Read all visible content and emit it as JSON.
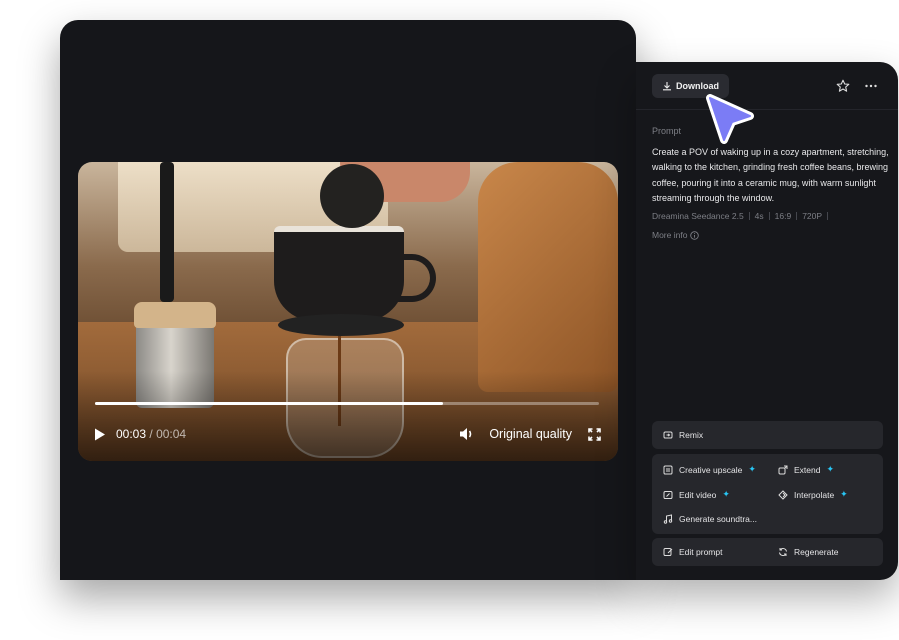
{
  "video": {
    "current_time": "00:03",
    "separator": "/",
    "total_time": "00:04",
    "progress": 0.69,
    "quality_label": "Original quality"
  },
  "panel": {
    "download_label": "Download",
    "prompt_label": "Prompt",
    "prompt_text": "Create a POV of waking up in a cozy apartment, stretching, walking to the kitchen, grinding fresh coffee beans, brewing coffee, pouring it into a ceramic mug, with warm sunlight streaming through the window.",
    "meta": [
      "Dreamina Seedance 2.5",
      "4s",
      "16:9",
      "720P"
    ],
    "more_info_label": "More info"
  },
  "actions": {
    "remix": "Remix",
    "creative_upscale": "Creative upscale",
    "extend": "Extend",
    "edit_video": "Edit video",
    "interpolate": "Interpolate",
    "generate_soundtrack": "Generate soundtra...",
    "edit_prompt": "Edit prompt",
    "regenerate": "Regenerate",
    "sparkle": "✦"
  },
  "colors": {
    "accent_sparkle": "#28c6f5",
    "cursor": "#7b7cf5",
    "panel_bg": "#16171b",
    "button_bg": "#26272c"
  },
  "icons": [
    "download-icon",
    "star-icon",
    "more-icon",
    "info-icon",
    "play-icon",
    "volume-icon",
    "fullscreen-icon",
    "remix-icon",
    "upscale-icon",
    "extend-icon",
    "edit-video-icon",
    "interpolate-icon",
    "music-icon",
    "edit-prompt-icon",
    "regenerate-icon",
    "cursor-icon"
  ]
}
